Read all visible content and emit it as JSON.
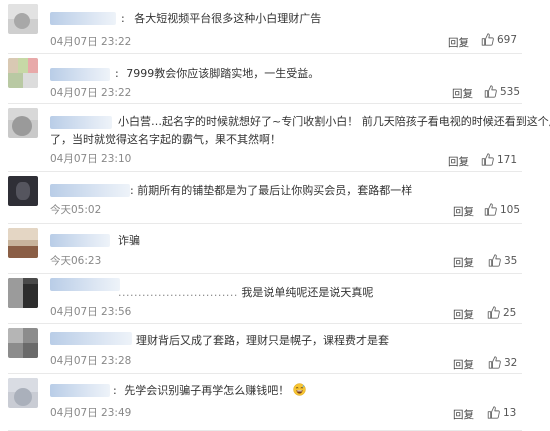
{
  "reply_label": "回复",
  "comments": [
    {
      "colon": ":",
      "text": "各大短视频平台很多这种小白理财广告",
      "time": "04月07日 23:22",
      "likes": "697"
    },
    {
      "colon": ":",
      "text": "7999教会你应该脚踏实地，一生受益。",
      "time": "04月07日 23:22",
      "likes": "535"
    },
    {
      "text_line1": "小白营…起名字的时候就想好了~专门收割小白！ 前几天陪孩子看电视的时候还看到这个广告",
      "text_line2": "了，当时就觉得这名字起的霸气，果不其然啊！",
      "time": "04月07日 23:10",
      "likes": "171"
    },
    {
      "colon": ":",
      "text": "前期所有的铺垫都是为了最后让你购买会员，套路都一样",
      "time": "今天05:02",
      "likes": "105"
    },
    {
      "text": "诈骗",
      "time": "今天06:23",
      "likes": "35"
    },
    {
      "dots": "..............................",
      "text": "我是说单纯呢还是说天真呢",
      "time": "04月07日 23:56",
      "likes": "25"
    },
    {
      "text": "理财背后又成了套路，理财只是幌子，课程费才是套",
      "time": "04月07日 23:28",
      "likes": "32"
    },
    {
      "colon": ":",
      "text": "先学会识别骗子再学怎么赚钱吧！",
      "emoji": "grinning-sweat-emoji",
      "time": "04月07日 23:49",
      "likes": "13"
    }
  ]
}
